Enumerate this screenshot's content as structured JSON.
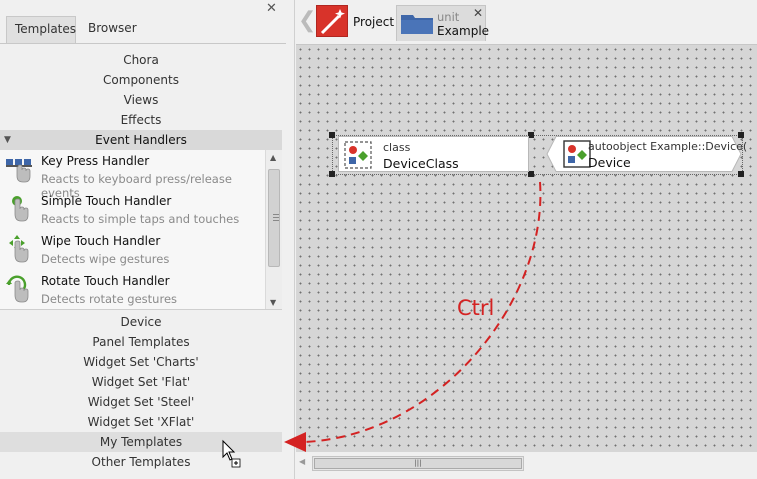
{
  "left_panel": {
    "tabs": [
      {
        "label": "Templates",
        "active": true
      },
      {
        "label": "Browser",
        "active": false
      }
    ],
    "groups_top": [
      "Chora",
      "Components",
      "Views",
      "Effects"
    ],
    "expanded_group": "Event Handlers",
    "items": [
      {
        "title": "Key Press Handler",
        "desc": "Reacts to keyboard press/release events",
        "icon": "keyboard-hand-icon"
      },
      {
        "title": "Simple Touch Handler",
        "desc": "Reacts to simple taps and touches",
        "icon": "tap-hand-icon"
      },
      {
        "title": "Wipe Touch Handler",
        "desc": "Detects wipe gestures",
        "icon": "wipe-hand-icon"
      },
      {
        "title": "Rotate Touch Handler",
        "desc": "Detects rotate gestures",
        "icon": "rotate-hand-icon"
      }
    ],
    "groups_bottom": [
      "Device",
      "Panel Templates",
      "Widget Set 'Charts'",
      "Widget Set 'Flat'",
      "Widget Set 'Steel'",
      "Widget Set 'XFlat'",
      "My Templates",
      "Other Templates"
    ],
    "highlighted_group": "My Templates"
  },
  "doc_tabs": {
    "project": {
      "label": "Project"
    },
    "unit": {
      "kind": "unit",
      "name": "Example"
    }
  },
  "canvas": {
    "bricks": [
      {
        "kind": "class",
        "name": "DeviceClass"
      },
      {
        "kind": "autoobject Example::Device(",
        "name": "Device"
      }
    ],
    "annotation": "Ctrl"
  },
  "colors": {
    "accent_red": "#d42222",
    "canvas_bg": "#d6d6d6",
    "project_red": "#d8332a",
    "unit_blue": "#3e66a8"
  }
}
